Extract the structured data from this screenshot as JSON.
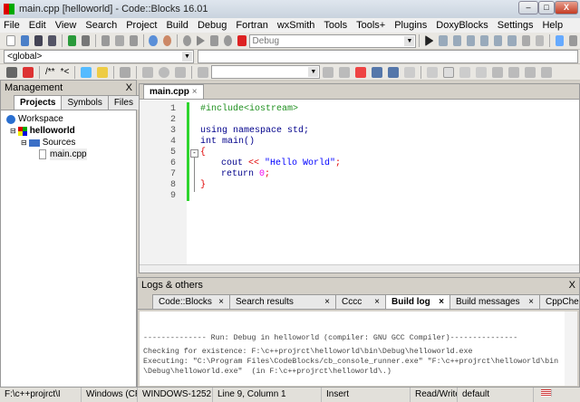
{
  "window": {
    "title": "main.cpp [helloworld] - Code::Blocks 16.01",
    "minimize": "‒",
    "maximize": "□",
    "close": "X"
  },
  "menu": [
    "File",
    "Edit",
    "View",
    "Search",
    "Project",
    "Build",
    "Debug",
    "Fortran",
    "wxSmith",
    "Tools",
    "Tools+",
    "Plugins",
    "DoxyBlocks",
    "Settings",
    "Help"
  ],
  "toolbar": {
    "build_target": "Debug",
    "scope": "<global>",
    "doc_comment": "/**",
    "line_comment": "*<"
  },
  "management": {
    "title": "Management",
    "close": "X",
    "tabs": [
      "Projects",
      "Symbols",
      "Files"
    ],
    "tree": {
      "workspace": "Workspace",
      "project": "helloworld",
      "folder": "Sources",
      "file": "main.cpp"
    }
  },
  "editor": {
    "tab": "main.cpp",
    "tab_close": "×",
    "line_numbers": [
      "1",
      "2",
      "3",
      "4",
      "5",
      "6",
      "7",
      "8",
      "9"
    ],
    "code": {
      "l1": "#include<iostream>",
      "l3a": "using namespace ",
      "l3b": "std;",
      "l4a": "int ",
      "l4b": "main()",
      "l5": "{",
      "l6a": "cout ",
      "l6b": "<<",
      "l6c": " \"Hello World\"",
      "l6d": ";",
      "l7a": "return ",
      "l7b": "0",
      "l7c": ";",
      "l8": "}"
    }
  },
  "logs": {
    "title": "Logs & others",
    "close": "X",
    "tabs": [
      {
        "label": "Code::Blocks",
        "active": false
      },
      {
        "label": "Search results",
        "active": false
      },
      {
        "label": "Cccc",
        "active": false
      },
      {
        "label": "Build log",
        "active": true
      },
      {
        "label": "Build messages",
        "active": false
      },
      {
        "label": "CppChe",
        "active": false
      }
    ],
    "lines": [
      "-------------- Run: Debug in helloworld (compiler: GNU GCC Compiler)---------------",
      "Checking for existence: F:\\c++projrct\\helloworld\\bin\\Debug\\helloworld.exe",
      "Executing: \"C:\\Program Files\\CodeBlocks/cb_console_runner.exe\" \"F:\\c++projrct\\helloworld\\bin",
      "\\Debug\\helloworld.exe\"  (in F:\\c++projrct\\helloworld\\.)"
    ]
  },
  "status": {
    "path": "F:\\c++projrct\\I",
    "eol": "Windows (CR+LF)",
    "encoding": "WINDOWS-1252",
    "position": "Line 9, Column 1",
    "mode": "Insert",
    "access": "Read/Write",
    "profile": "default"
  }
}
